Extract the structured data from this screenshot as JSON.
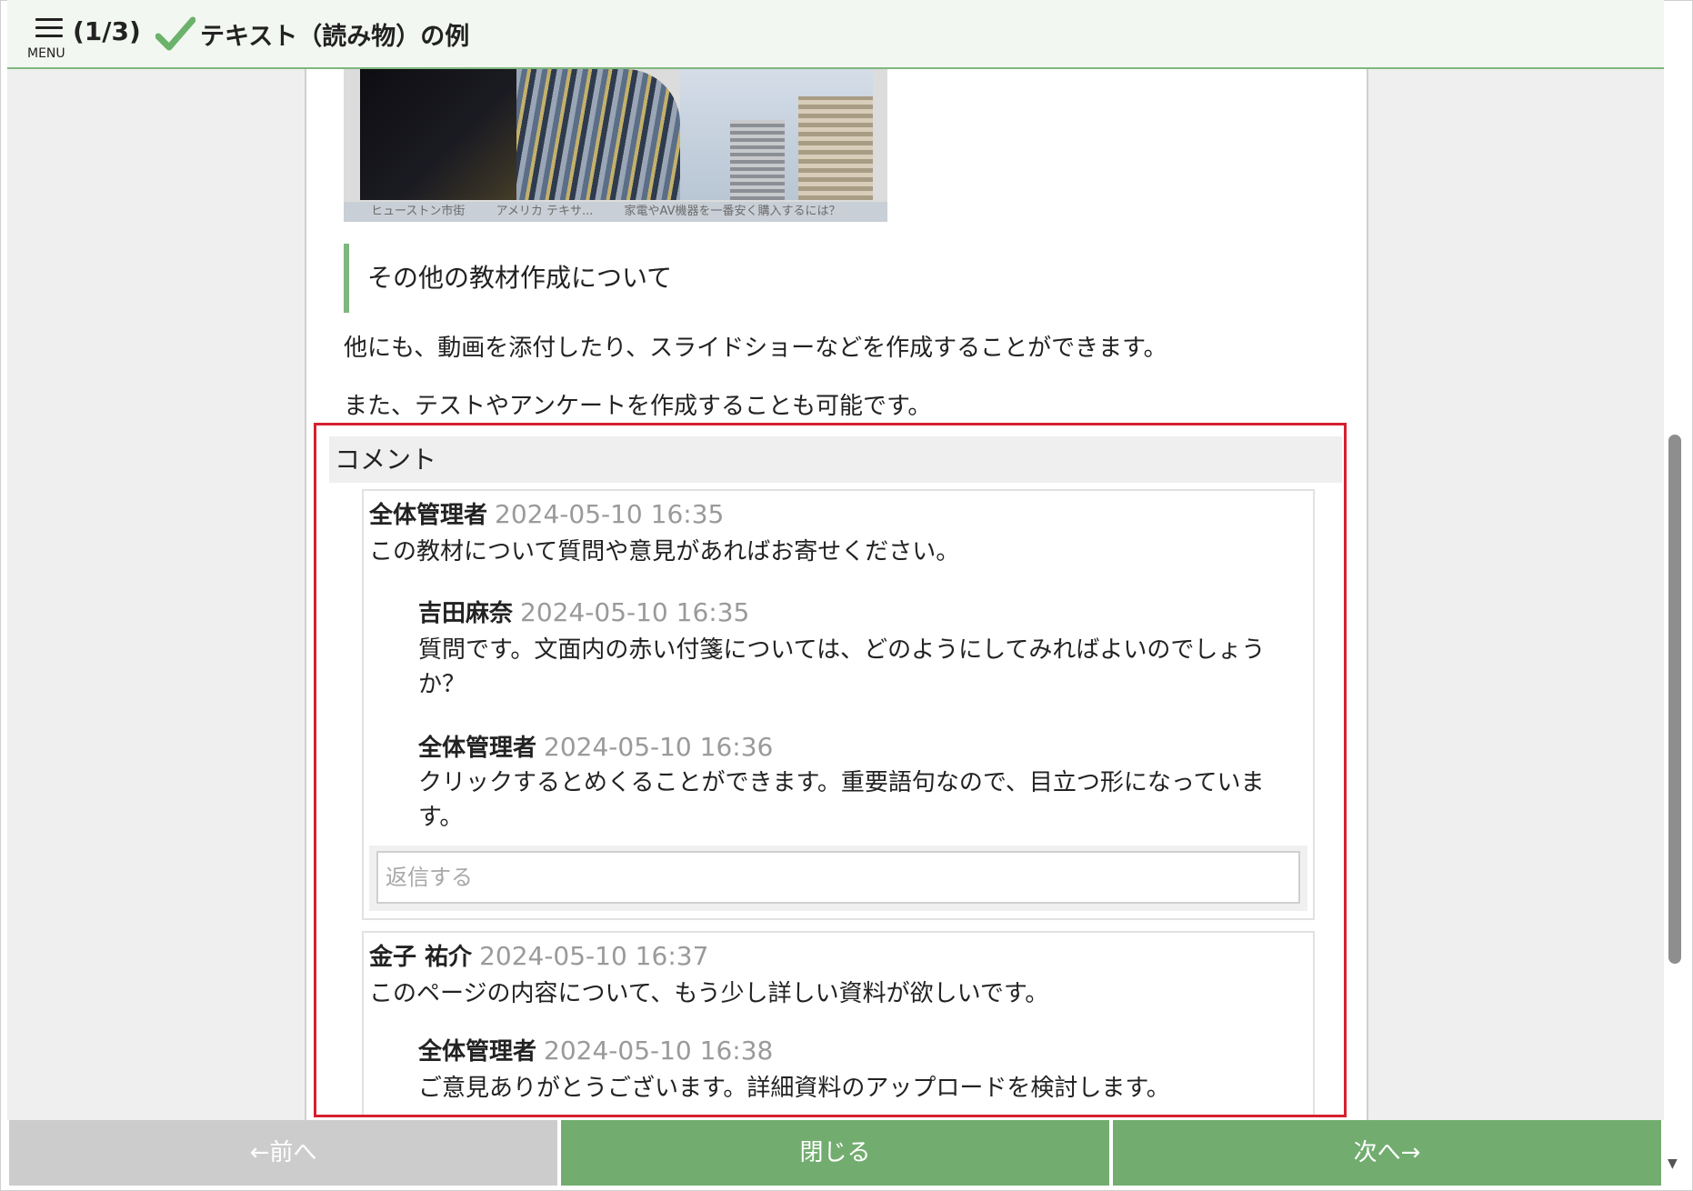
{
  "header": {
    "menu_label": "MENU",
    "page_counter": "(1/3)",
    "title": "テキスト（読み物）の例",
    "accent_color": "#7fb77e"
  },
  "image": {
    "captions": [
      "ヒューストン市街",
      "アメリカ テキサ...",
      "家電やAV機器を一番安く購入するには？"
    ]
  },
  "section": {
    "heading": "その他の教材作成について",
    "paragraphs": [
      "他にも、動画を添付したり、スライドショーなどを作成することができます。",
      "また、テストやアンケートを作成することも可能です。"
    ]
  },
  "comments": {
    "header": "コメント",
    "threads": [
      {
        "author": "全体管理者",
        "time": "2024-05-10 16:35",
        "text": "この教材について質問や意見があればお寄せください。",
        "replies": [
          {
            "author": "吉田麻奈",
            "time": "2024-05-10 16:35",
            "text_line1": "質問です。文面内の赤い付箋については、どのようにしてみればよいのでしょう",
            "text_line2": "か？"
          },
          {
            "author": "全体管理者",
            "time": "2024-05-10 16:36",
            "text_line1": "クリックするとめくることができます。重要語句なので、目立つ形になっていま",
            "text_line2": "す。"
          }
        ],
        "reply_placeholder": "返信する"
      },
      {
        "author": "金子 祐介",
        "time": "2024-05-10 16:37",
        "text": "このページの内容について、もう少し詳しい資料が欲しいです。",
        "replies": [
          {
            "author": "全体管理者",
            "time": "2024-05-10 16:38",
            "text_line1": "ご意見ありがとうございます。詳細資料のアップロードを検討します。"
          }
        ]
      }
    ]
  },
  "footer": {
    "prev_label": "←前へ",
    "close_label": "閉じる",
    "next_label": "次へ→"
  }
}
